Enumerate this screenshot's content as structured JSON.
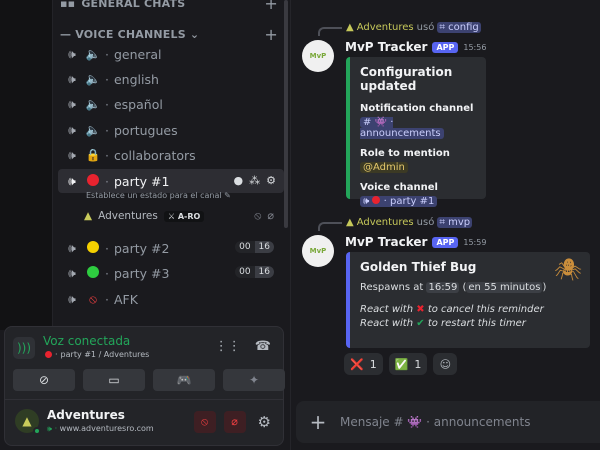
{
  "sidebar": {
    "categories": {
      "general_chats": "GENERAL CHATS",
      "voice_channels": "VOICE CHANNELS"
    },
    "channels": {
      "general": {
        "name": "general",
        "emoji": "🔈"
      },
      "english": {
        "name": "english",
        "emoji": "🔈"
      },
      "espanol": {
        "name": "español",
        "emoji": "🔈"
      },
      "portugues": {
        "name": "portugues",
        "emoji": "🔈"
      },
      "collaborators": {
        "name": "collaborators",
        "emoji": "🔒"
      },
      "party1": {
        "name": "party #1",
        "status_text": "Establece un estado para el canal"
      },
      "party2": {
        "name": "party #2",
        "count_a": "00",
        "count_b": "16"
      },
      "party3": {
        "name": "party #3",
        "count_a": "00",
        "count_b": "16"
      },
      "afk": {
        "name": "AFK"
      }
    },
    "member": {
      "name": "Adventures",
      "tag": "A-RO"
    }
  },
  "voice_panel": {
    "status": "Voz conectada",
    "location": "party #1 / Adventures"
  },
  "user_panel": {
    "name": "Adventures",
    "subtitle": "www.adventuresro.com"
  },
  "messages": [
    {
      "reply_user": "Adventures",
      "reply_verb": "usó",
      "command": "config",
      "bot_name": "MvP Tracker",
      "badge": "APP",
      "time": "15:56",
      "embed": {
        "title": "Configuration updated",
        "fields": [
          {
            "name": "Notification channel",
            "value": "announcements"
          },
          {
            "name": "Role to mention",
            "value": "@Admin"
          },
          {
            "name": "Voice channel",
            "value": "party #1"
          }
        ]
      }
    },
    {
      "reply_user": "Adventures",
      "reply_verb": "usó",
      "command": "mvp",
      "bot_name": "MvP Tracker",
      "badge": "APP",
      "time": "15:59",
      "embed": {
        "title": "Golden Thief Bug",
        "respawn_prefix": "Respawns at",
        "respawn_time": "16:59",
        "respawn_relative": "en 55 minutos",
        "line1_a": "React with",
        "line1_b": "to cancel this reminder",
        "line2_a": "React with",
        "line2_b": "to restart this timer"
      },
      "reactions": [
        {
          "emoji": "❌",
          "count": "1"
        },
        {
          "emoji": "✅",
          "count": "1"
        }
      ]
    }
  ],
  "composer": {
    "placeholder": "Mensaje #",
    "channel": "announcements"
  },
  "colors": {
    "accent": "#5865f2",
    "online": "#23a55a",
    "danger": "#f23f42"
  }
}
